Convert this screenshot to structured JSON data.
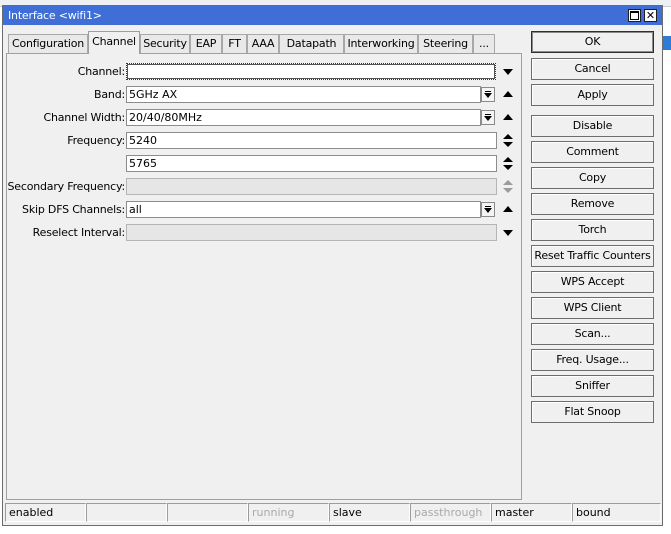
{
  "window": {
    "title": "Interface <wifi1>"
  },
  "tabs": [
    "Configuration",
    "Channel",
    "Security",
    "EAP",
    "FT",
    "AAA",
    "Datapath",
    "Interworking",
    "Steering",
    "..."
  ],
  "active_tab": "Channel",
  "form": {
    "channel": {
      "label": "Channel:",
      "value": ""
    },
    "band": {
      "label": "Band:",
      "value": "5GHz AX"
    },
    "channel_width": {
      "label": "Channel Width:",
      "value": "20/40/80MHz"
    },
    "frequency": {
      "label": "Frequency:",
      "value1": "5240",
      "value2": "5765"
    },
    "secondary_frequency": {
      "label": "Secondary Frequency:",
      "value": ""
    },
    "skip_dfs": {
      "label": "Skip DFS Channels:",
      "value": "all"
    },
    "reselect_interval": {
      "label": "Reselect Interval:",
      "value": ""
    }
  },
  "buttons": [
    "OK",
    "Cancel",
    "Apply",
    "Disable",
    "Comment",
    "Copy",
    "Remove",
    "Torch",
    "Reset Traffic Counters",
    "WPS Accept",
    "WPS Client",
    "Scan...",
    "Freq. Usage...",
    "Sniffer",
    "Flat Snoop"
  ],
  "status": {
    "items": [
      "enabled",
      "",
      "",
      "running",
      "slave",
      "passthrough",
      "master",
      "bound"
    ],
    "dimmed": [
      false,
      false,
      false,
      true,
      false,
      true,
      false,
      false
    ]
  },
  "colors": {
    "titlebar": "#3f6fd6",
    "panel": "#f0f0f0"
  }
}
